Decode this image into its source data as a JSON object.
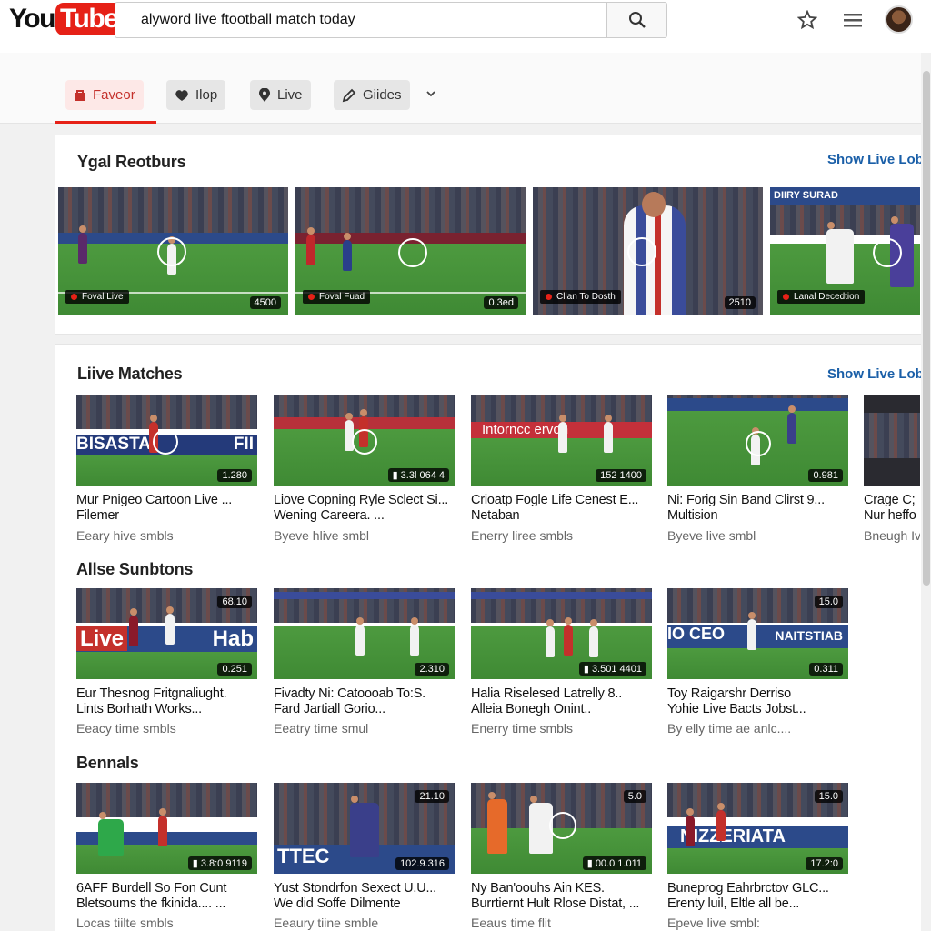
{
  "header": {
    "logo_you": "You",
    "logo_tube": "Tube",
    "search_value": "alyword live ftootball match today",
    "icons": [
      "search-icon",
      "star-icon",
      "menu-icon",
      "avatar"
    ]
  },
  "tabs": [
    {
      "label": "Faveor",
      "icon": "bag-icon",
      "active": true
    },
    {
      "label": "Ilop",
      "icon": "heart-icon",
      "active": false
    },
    {
      "label": "Live",
      "icon": "pin-icon",
      "active": false
    },
    {
      "label": "Giides",
      "icon": "pencil-icon",
      "active": false
    }
  ],
  "featured": {
    "title": "Ygal Reotburs",
    "show_link": "Show Live Lob",
    "items": [
      {
        "tag": "Foval Live",
        "badge": "4500"
      },
      {
        "tag": "Foval Fuad",
        "badge": "0.3ed"
      },
      {
        "tag": "Cllan To Dosth",
        "badge": "2510"
      },
      {
        "tag": "Lanal Decedtion",
        "badge": ""
      }
    ]
  },
  "live_matches": {
    "title": "Liive Matches",
    "show_link": "Show Live Lob",
    "items": [
      {
        "badge": "1.280",
        "title1": "Mur Pnigeo Cartoon Live ...",
        "title2": "Filemer",
        "meta": "Eeary hive smbls"
      },
      {
        "badge": "▮ 3.3l 064 4",
        "title1": "Liove Copning Ryle Sclect Si...",
        "title2": "Wening Careera. ...",
        "meta": "Byeve hlive smbl"
      },
      {
        "badge": "152 1400",
        "title1": "Crioatp Fogle Life Cenest E...",
        "title2": "Netaban",
        "meta": "Enerry liree smbls"
      },
      {
        "badge": "0.981",
        "title1": "Ni: Forig Sin Band Clirst 9...",
        "title2": "Multision",
        "meta": "Byeve live smbl"
      },
      {
        "badge": "",
        "title1": "Crage C;",
        "title2": "Nur heffo",
        "meta": "Bneugh Iv"
      }
    ]
  },
  "allse": {
    "title": "Allse Sunbtons",
    "items": [
      {
        "badge": "0.251",
        "top_badge": "68.10",
        "title1": "Eur Thesnog Fritgnaliught.",
        "title2": "Lints Borhath Works...",
        "meta": "Eeacy time smbls"
      },
      {
        "badge": "2.310",
        "top_badge": "",
        "title1": "Fivadty Ni: Catoooab To:S.",
        "title2": "Fard Jartiall Gorio...",
        "meta": "Eeatry time smul"
      },
      {
        "badge": "▮ 3.501 4401",
        "top_badge": "",
        "title1": "Halia Riselesed Latrelly 8..",
        "title2": "Alleia Bonegh Onint..",
        "meta": "Enerry time smbls"
      },
      {
        "badge": "0.311",
        "top_badge": "15.0",
        "title1": "Toy Raigarshr Derriso",
        "title2": "Yohie Live Bacts Jobst...",
        "meta": "By elly time ae anlc...."
      }
    ]
  },
  "bennals": {
    "title": "Bennals",
    "items": [
      {
        "badge": "▮ 3.8:0 9119",
        "top_badge": "",
        "title1": "6AFF Burdell So Fon Cunt",
        "title2": "Bletsoums the fkinida.... ...",
        "meta": "Locas tiilte smbls"
      },
      {
        "badge": "102.9.316",
        "top_badge": "21.10",
        "title1": "Yust Stondrfon Sexect U.U...",
        "title2": "We did Soffe Dilmente",
        "meta": "Eeaury tiine smble"
      },
      {
        "badge": "▮ 00.0 1.011",
        "top_badge": "5.0",
        "title1": "Ny Ban'oouhs Ain KES.",
        "title2": "Burrtiernt Hult Rlose Distat, ...",
        "meta": "Eeaus time flit"
      },
      {
        "badge": "17.2:0",
        "top_badge": "15.0",
        "title1": "Buneprog Eahrbrctov GLC...",
        "title2": "Erenty luil, Eltle all be...",
        "meta": "Epeve live smbl:"
      }
    ]
  },
  "board_texts": [
    "BISASTA",
    "FII",
    "Intorncc ervon",
    "LIVE",
    "Live",
    "Hab",
    "IO CEO",
    "NAITSTIAB",
    "NIZZERIATA",
    "TTEC",
    "DIIRY SURAD"
  ],
  "colors": {
    "accent": "#e62117",
    "link": "#1a5fa8",
    "pitch": "#3f8a34"
  }
}
